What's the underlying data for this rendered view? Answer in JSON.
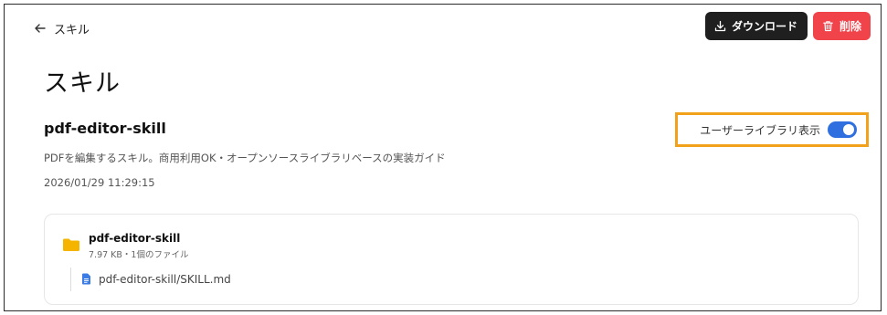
{
  "nav": {
    "back_label": "スキル"
  },
  "toolbar": {
    "download_label": "ダウンロード",
    "delete_label": "削除"
  },
  "page": {
    "title": "スキル"
  },
  "skill": {
    "name": "pdf-editor-skill",
    "description": "PDFを編集するスキル。商用利用OK・オープンソースライブラリベースの実装ガイド",
    "date": "2026/01/29 11:29:15",
    "visibility_label": "ユーザーライブラリ表示",
    "visibility_on": true
  },
  "files": {
    "folder_name": "pdf-editor-skill",
    "folder_meta": "7.97 KB・1個のファイル",
    "items": [
      {
        "path": "pdf-editor-skill/SKILL.md"
      }
    ]
  },
  "colors": {
    "download_bg": "#1f1f1f",
    "delete_bg": "#f0434a",
    "toggle_on": "#2f6fe0",
    "highlight": "#f2a21a",
    "folder": "#f5b400",
    "file": "#3a7be6"
  },
  "icons": {
    "back": "arrow-left-icon",
    "download": "download-icon",
    "delete": "trash-icon",
    "folder": "folder-icon",
    "file": "file-icon"
  }
}
